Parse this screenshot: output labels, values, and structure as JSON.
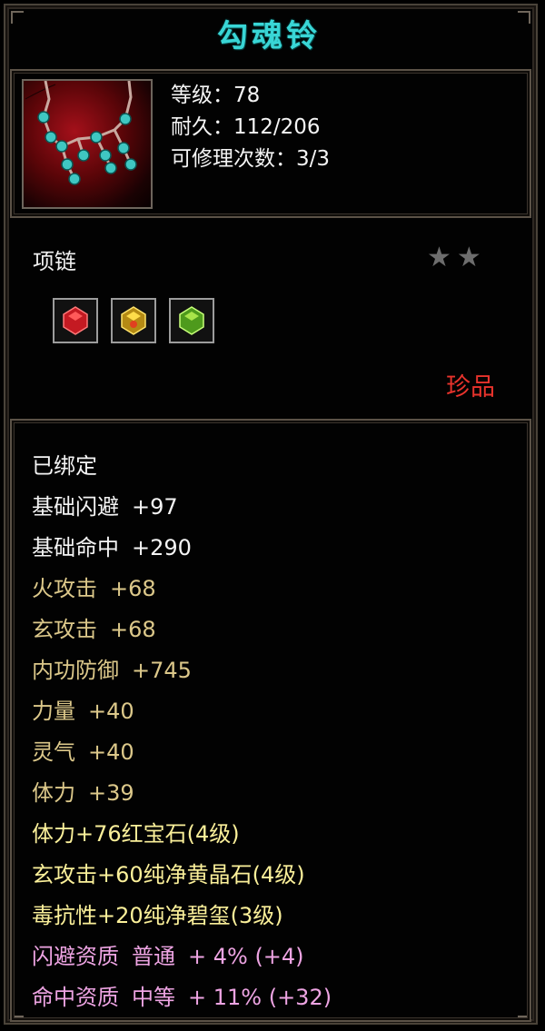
{
  "item": {
    "name": "勾魂铃",
    "stats": [
      {
        "label": "等级：",
        "value": "78"
      },
      {
        "label": "耐久：",
        "value": "112/206"
      },
      {
        "label": "可修理次数：",
        "value": "3/3"
      }
    ],
    "type": "项链",
    "star_count": 2,
    "rarity": "珍品",
    "rarity_color": "#e8332c",
    "gems": [
      {
        "name": "red-gem-icon",
        "color": "#d21e2a"
      },
      {
        "name": "yellow-gem-icon",
        "color": "#e2c13a"
      },
      {
        "name": "green-gem-icon",
        "color": "#8bd23a"
      }
    ]
  },
  "properties": {
    "bound": "已绑定",
    "base": [
      {
        "label": "基础闪避",
        "value": "+97"
      },
      {
        "label": "基础命中",
        "value": "+290"
      }
    ],
    "attrs": [
      {
        "label": "火攻击",
        "value": "+68"
      },
      {
        "label": "玄攻击",
        "value": "+68"
      },
      {
        "label": "内功防御",
        "value": "+745"
      },
      {
        "label": "力量",
        "value": "+40"
      },
      {
        "label": "灵气",
        "value": "+40"
      },
      {
        "label": "体力",
        "value": "+39"
      }
    ],
    "gem_bonuses": [
      "体力+76红宝石(4级)",
      "玄攻击+60纯净黄晶石(4级)",
      "毒抗性+20纯净碧玺(3级)"
    ],
    "qualities": [
      {
        "label": "闪避资质",
        "grade": "普通",
        "value": "+ 4% (+4)"
      },
      {
        "label": "命中资质",
        "grade": "中等",
        "value": "+ 11% (+32)"
      }
    ]
  },
  "colors": {
    "title": "#39d6d6",
    "base_text": "#f4f4f4",
    "attr_text": "#dcc88a",
    "gem_text": "#fbf09a",
    "quality_text": "#eea4e3"
  }
}
